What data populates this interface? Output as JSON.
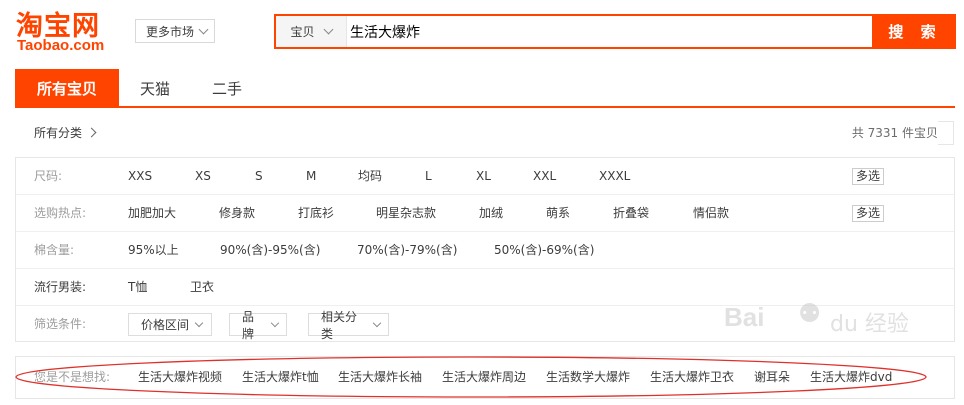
{
  "logo": {
    "cn": "淘宝网",
    "en": "Taobao.com"
  },
  "header": {
    "more_market": "更多市场"
  },
  "search": {
    "type": "宝贝",
    "value": "生活大爆炸",
    "button": "搜 索"
  },
  "tabs": [
    {
      "label": "所有宝贝",
      "active": true
    },
    {
      "label": "天猫",
      "active": false
    },
    {
      "label": "二手",
      "active": false
    }
  ],
  "category": {
    "all": "所有分类",
    "total": "共 7331 件宝贝"
  },
  "filters": {
    "size": {
      "label": "尺码:",
      "items": [
        "XXS",
        "XS",
        "S",
        "M",
        "均码",
        "L",
        "XL",
        "XXL",
        "XXXL"
      ],
      "multi": "多选"
    },
    "hot": {
      "label": "选购热点:",
      "items": [
        "加肥加大",
        "修身款",
        "打底衫",
        "明星杂志款",
        "加绒",
        "萌系",
        "折叠袋",
        "情侣款"
      ],
      "multi": "多选"
    },
    "cotton": {
      "label": "棉含量:",
      "items": [
        "95%以上",
        "90%(含)-95%(含)",
        "70%(含)-79%(含)",
        "50%(含)-69%(含)"
      ]
    },
    "menswear": {
      "label": "流行男装:",
      "items": [
        "T恤",
        "卫衣"
      ]
    },
    "conditions": {
      "label": "筛选条件:",
      "dropdowns": [
        "价格区间",
        "品牌",
        "相关分类"
      ]
    }
  },
  "suggestions": {
    "label": "您是不是想找:",
    "items": [
      "生活大爆炸视频",
      "生活大爆炸t恤",
      "生活大爆炸长袖",
      "生活大爆炸周边",
      "生活数学大爆炸",
      "生活大爆炸卫衣",
      "谢耳朵",
      "生活大爆炸dvd"
    ]
  },
  "watermark": {
    "text": "Bai",
    "suffix": "du",
    "cn": "经验"
  },
  "colors": {
    "accent": "#ff4400",
    "annotation": "#e0302a"
  }
}
